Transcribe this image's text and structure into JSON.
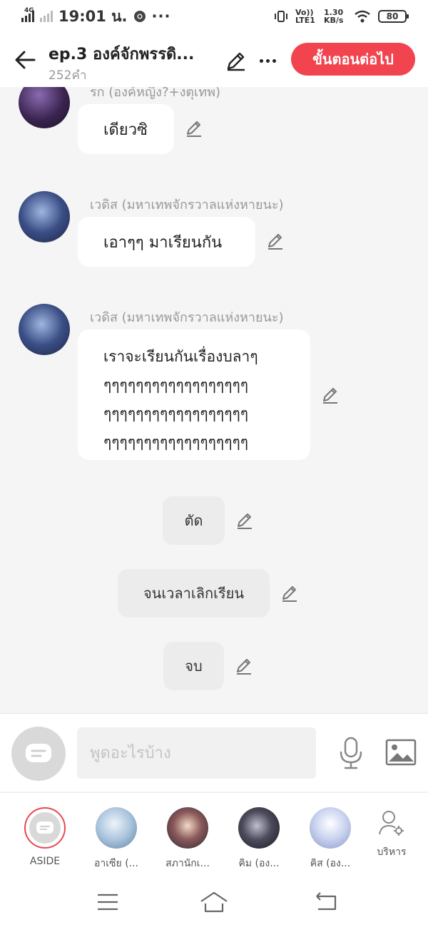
{
  "status_bar": {
    "network": "4G",
    "time": "19:01 น.",
    "volte": "Vo)) LTE1",
    "speed": "1.30 KB/s",
    "battery": "80"
  },
  "header": {
    "title": "ep.3 องค์จักพรรดิ...",
    "word_count": "252คำ",
    "next_button": "ขั้นตอนต่อไป"
  },
  "messages": [
    {
      "type": "bubble",
      "speaker": "รก (องค์หญิง?+งตุเทพ)",
      "text": "เดียวซิ"
    },
    {
      "type": "bubble",
      "speaker": "เวดิส (มหาเทพจักรวาลแห่งหายนะ)",
      "text": "เอาๆๆ มาเรียนกัน"
    },
    {
      "type": "bubble",
      "speaker": "เวดิส (มหาเทพจักรวาลแห่งหายนะ)",
      "text": "เราจะเรียนกันเรื่องบลาๆ\nๆๆๆๆๆๆๆๆๆๆๆๆๆๆๆๆๆๆ\nๆๆๆๆๆๆๆๆๆๆๆๆๆๆๆๆๆๆ\nๆๆๆๆๆๆๆๆๆๆๆๆๆๆๆๆๆๆ"
    },
    {
      "type": "narration",
      "text": "ตัด"
    },
    {
      "type": "narration",
      "text": "จนเวลาเลิกเรียน"
    },
    {
      "type": "narration",
      "text": "จบ"
    }
  ],
  "input": {
    "placeholder": "พูดอะไรบ้าง"
  },
  "characters": [
    {
      "label": "ASIDE"
    },
    {
      "label": "อาเซีย (..."
    },
    {
      "label": "สภานักเ..."
    },
    {
      "label": "คิม (อง..."
    },
    {
      "label": "คิส (อง..."
    }
  ],
  "manage_label": "บริหาร",
  "colors": {
    "accent": "#f2444e",
    "bubble": "#ffffff",
    "narration": "#ececec",
    "background": "#f5f5f5"
  }
}
